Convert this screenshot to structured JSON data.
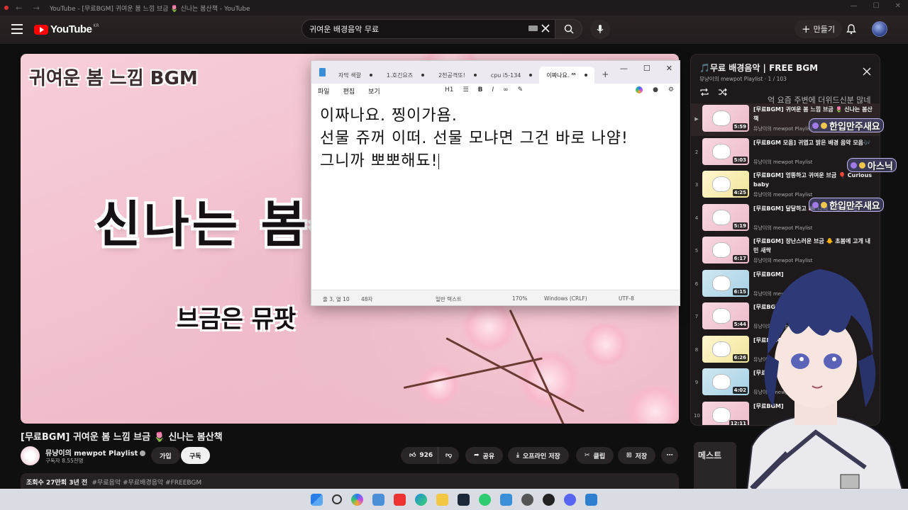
{
  "browser": {
    "title": "YouTube - [무료BGM] 귀여운 봄 느낌 브금 🌷 신나는 봄산책 - YouTube"
  },
  "youtube": {
    "logo_text": "YouTube",
    "logo_region": "KR",
    "search_query": "귀여운 배경음악 무료",
    "create_label": "만들기"
  },
  "player": {
    "overlay_title": "귀여운 봄 느낌 BGM",
    "big_text": "신나는 봄산",
    "sub_text": "브금은 뮤팟"
  },
  "notepad": {
    "tabs": [
      {
        "label": "자막 색깔",
        "modified": true
      },
      {
        "label": "1.호긴요즈",
        "modified": true
      },
      {
        "label": "2천공격또!",
        "modified": true
      },
      {
        "label": "cpu i5-134",
        "modified": true
      },
      {
        "label": "이짜나요. ᄍ",
        "modified": true,
        "active": true
      }
    ],
    "menu": [
      "파일",
      "편집",
      "보기"
    ],
    "heading_select": "H1",
    "lines": [
      "이짜나요. 찡이가욤.",
      "선물 쥬꺼 이떠. 선물 모냐면 그건 바로 나얌!",
      "그니까 뽀뽀해됴!"
    ],
    "status": {
      "position": "줄 3, 열 10",
      "chars": "48자",
      "format": "일반 텍스트",
      "zoom": "170%",
      "line_ending": "Windows (CRLF)",
      "encoding": "UTF-8"
    }
  },
  "video": {
    "title": "[무료BGM] 귀여운 봄 느낌 브금 🌷 신나는 봄산책",
    "channel": "뮤냥이의 mewpot Playlist",
    "subscribers": "구독자 8.55천명",
    "join_label": "가입",
    "subscribe_label": "구독",
    "likes": "926",
    "share_label": "공유",
    "download_label": "오프라인 저장",
    "clip_label": "클립",
    "save_label": "저장",
    "views_date": "조회수 27만회  3년 전",
    "tags": "#무료음악 #무료배경음악 #FREEBGM"
  },
  "playlist": {
    "title": "🎵무료 배경음악 | FREE BGM",
    "meta": "뮤냥이의 mewpot Playlist · 1 / 103",
    "items": [
      {
        "index": "▶",
        "title": "[무료BGM] 귀여운 봄 느낌 브금 🌷 신나는 봄산책",
        "channel": "뮤냥이의 mewpot Playlist",
        "duration": "5:59",
        "thumb": "p"
      },
      {
        "index": "2",
        "title": "[무료BGM 모음] 귀엽고 밝은 배경 음악 모음🎶",
        "channel": "뮤냥이의 mewpot Playlist",
        "duration": "5:03",
        "thumb": "p"
      },
      {
        "index": "3",
        "title": "[무료BGM] 엉뚱하고 귀여운 브금 🎈 Curious baby",
        "channel": "뮤냥이의 mewpot Playlist",
        "duration": "4:25",
        "thumb": "y"
      },
      {
        "index": "4",
        "title": "[무료BGM] 달달하고 📖 나의 예쁜 실로폰",
        "channel": "뮤냥이의 mewpot Playlist",
        "duration": "5:19",
        "thumb": "p"
      },
      {
        "index": "5",
        "title": "[무료BGM] 장난스러운 브금 🐥 초봄에 고개 내민 새싹",
        "channel": "뮤냥이의 mewpot Playlist",
        "duration": "6:17",
        "thumb": "p"
      },
      {
        "index": "6",
        "title": "[무료BGM]",
        "channel": "뮤냥이의 mewpot Playlist",
        "duration": "6:15",
        "thumb": "b"
      },
      {
        "index": "7",
        "title": "[무료BGM]",
        "channel": "뮤냥이의 mewpot Playlist",
        "duration": "5:44",
        "thumb": "p"
      },
      {
        "index": "8",
        "title": "[무료BGM]",
        "channel": "뮤냥이의 mewpot Playlist",
        "duration": "6:26",
        "thumb": "y"
      },
      {
        "index": "9",
        "title": "[무료BGM] 🧭 엉뚱한",
        "channel": "뮤냥이의 mewpot Playlist",
        "duration": "4:02",
        "thumb": "b"
      },
      {
        "index": "10",
        "title": "[무료BGM]",
        "channel": "",
        "duration": "12:11",
        "thumb": "p"
      }
    ]
  },
  "chat": {
    "ghost_text": "억 요즘 주변에 더위드신분 많네",
    "bubbles": [
      "한입만주새요",
      "아스닉",
      "한입만주새요"
    ]
  },
  "stream_overlay": {
    "label": "메스트"
  },
  "colors": {
    "yt_red": "#ff0000",
    "page_bg": "#0f0f0f",
    "video_pink": "#f3c1cf"
  }
}
